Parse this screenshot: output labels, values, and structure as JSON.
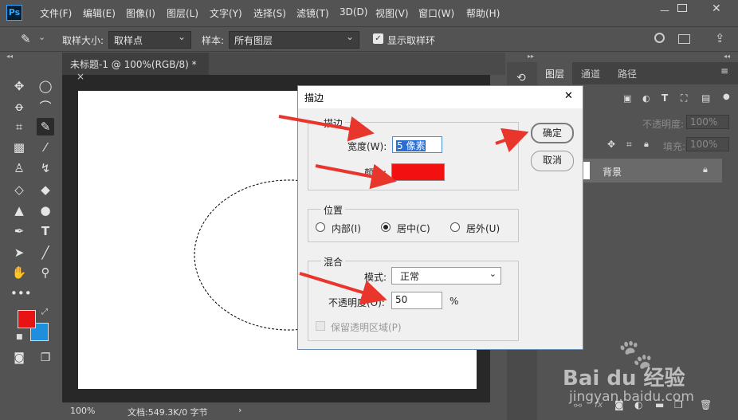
{
  "menubar": {
    "logo": "Ps",
    "items": [
      "文件(F)",
      "编辑(E)",
      "图像(I)",
      "图层(L)",
      "文字(Y)",
      "选择(S)",
      "滤镜(T)",
      "3D(D)",
      "视图(V)",
      "窗口(W)",
      "帮助(H)"
    ]
  },
  "options": {
    "sample_size_label": "取样大小:",
    "sample_size_value": "取样点",
    "sample_label": "样本:",
    "sample_value": "所有图层",
    "show_ring_label": "显示取样环"
  },
  "document": {
    "tab_title": "未标题-1 @ 100%(RGB/8) *",
    "tab_close": "×"
  },
  "colors": {
    "foreground": "#e81414",
    "background": "#1e8fdd",
    "stroke_color": "#f21010",
    "arrow": "#e8362d"
  },
  "status": {
    "zoom": "100%",
    "doc_info": "文档:549.3K/0 字节",
    "more": "›"
  },
  "panel": {
    "tabs": [
      "图层",
      "通道",
      "路径"
    ],
    "opacity_label": "不透明度:",
    "opacity_value": "100%",
    "fill_label": "填充:",
    "fill_value": "100%",
    "layer_name": "背景"
  },
  "dialog": {
    "title": "描边",
    "close": "✕",
    "stroke_group": "描边",
    "width_label": "宽度(W):",
    "width_value": "5 像素",
    "color_label": "颜色:",
    "position_group": "位置",
    "pos_inside": "内部(I)",
    "pos_center": "居中(C)",
    "pos_outside": "居外(U)",
    "blend_group": "混合",
    "mode_label": "模式:",
    "mode_value": "正常",
    "opacity_label": "不透明度(O):",
    "opacity_value": "50",
    "opacity_unit": "%",
    "preserve_label": "保留透明区域(P)",
    "ok_label": "确定",
    "cancel_label": "取消"
  },
  "watermark": {
    "brand": "Bai du 经验",
    "url": "jingyan.baidu.com"
  }
}
